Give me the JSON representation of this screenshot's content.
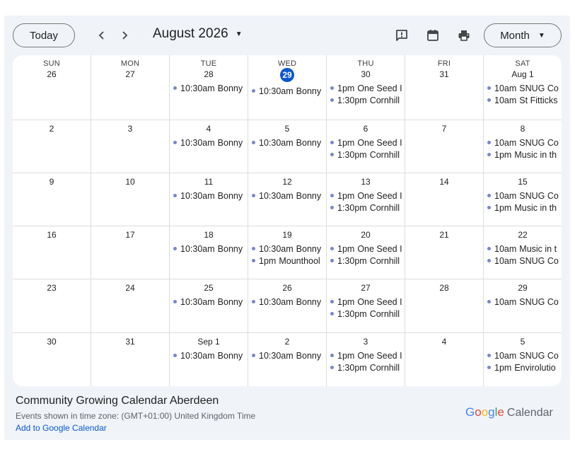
{
  "toolbar": {
    "today_label": "Today",
    "month_title": "August 2026",
    "view_label": "Month",
    "icons": [
      "chevron-left-icon",
      "chevron-right-icon",
      "feedback-icon",
      "calendar-icon",
      "print-icon",
      "caret-down-icon"
    ]
  },
  "weekdays": [
    "SUN",
    "MON",
    "TUE",
    "WED",
    "THU",
    "FRI",
    "SAT"
  ],
  "weeks": [
    [
      {
        "day": "26",
        "events": []
      },
      {
        "day": "27",
        "events": []
      },
      {
        "day": "28",
        "events": [
          {
            "time": "10:30am",
            "title": "Bonny"
          }
        ]
      },
      {
        "day": "29",
        "today": true,
        "events": [
          {
            "time": "10:30am",
            "title": "Bonny"
          }
        ]
      },
      {
        "day": "30",
        "events": [
          {
            "time": "1pm",
            "title": "One Seed I"
          },
          {
            "time": "1:30pm",
            "title": "Cornhill"
          }
        ]
      },
      {
        "day": "31",
        "events": []
      },
      {
        "day": "Aug 1",
        "events": [
          {
            "time": "10am",
            "title": "SNUG Co"
          },
          {
            "time": "10am",
            "title": "St Fitticks"
          }
        ]
      }
    ],
    [
      {
        "day": "2",
        "events": []
      },
      {
        "day": "3",
        "events": []
      },
      {
        "day": "4",
        "events": [
          {
            "time": "10:30am",
            "title": "Bonny"
          }
        ]
      },
      {
        "day": "5",
        "events": [
          {
            "time": "10:30am",
            "title": "Bonny"
          }
        ]
      },
      {
        "day": "6",
        "events": [
          {
            "time": "1pm",
            "title": "One Seed I"
          },
          {
            "time": "1:30pm",
            "title": "Cornhill"
          }
        ]
      },
      {
        "day": "7",
        "events": []
      },
      {
        "day": "8",
        "events": [
          {
            "time": "10am",
            "title": "SNUG Co"
          },
          {
            "time": "1pm",
            "title": "Music in th"
          }
        ]
      }
    ],
    [
      {
        "day": "9",
        "events": []
      },
      {
        "day": "10",
        "events": []
      },
      {
        "day": "11",
        "events": [
          {
            "time": "10:30am",
            "title": "Bonny"
          }
        ]
      },
      {
        "day": "12",
        "events": [
          {
            "time": "10:30am",
            "title": "Bonny"
          }
        ]
      },
      {
        "day": "13",
        "events": [
          {
            "time": "1pm",
            "title": "One Seed I"
          },
          {
            "time": "1:30pm",
            "title": "Cornhill"
          }
        ]
      },
      {
        "day": "14",
        "events": []
      },
      {
        "day": "15",
        "events": [
          {
            "time": "10am",
            "title": "SNUG Co"
          },
          {
            "time": "1pm",
            "title": "Music in th"
          }
        ]
      }
    ],
    [
      {
        "day": "16",
        "events": []
      },
      {
        "day": "17",
        "events": []
      },
      {
        "day": "18",
        "events": [
          {
            "time": "10:30am",
            "title": "Bonny"
          }
        ]
      },
      {
        "day": "19",
        "events": [
          {
            "time": "10:30am",
            "title": "Bonny"
          },
          {
            "time": "1pm",
            "title": "Mounthool"
          }
        ]
      },
      {
        "day": "20",
        "events": [
          {
            "time": "1pm",
            "title": "One Seed I"
          },
          {
            "time": "1:30pm",
            "title": "Cornhill"
          }
        ]
      },
      {
        "day": "21",
        "events": []
      },
      {
        "day": "22",
        "events": [
          {
            "time": "10am",
            "title": "Music in t"
          },
          {
            "time": "10am",
            "title": "SNUG Co"
          }
        ]
      }
    ],
    [
      {
        "day": "23",
        "events": []
      },
      {
        "day": "24",
        "events": []
      },
      {
        "day": "25",
        "events": [
          {
            "time": "10:30am",
            "title": "Bonny"
          }
        ]
      },
      {
        "day": "26",
        "events": [
          {
            "time": "10:30am",
            "title": "Bonny"
          }
        ]
      },
      {
        "day": "27",
        "events": [
          {
            "time": "1pm",
            "title": "One Seed I"
          },
          {
            "time": "1:30pm",
            "title": "Cornhill"
          }
        ]
      },
      {
        "day": "28",
        "events": []
      },
      {
        "day": "29",
        "events": [
          {
            "time": "10am",
            "title": "SNUG Co"
          }
        ]
      }
    ],
    [
      {
        "day": "30",
        "events": []
      },
      {
        "day": "31",
        "events": []
      },
      {
        "day": "Sep 1",
        "events": [
          {
            "time": "10:30am",
            "title": "Bonny"
          }
        ]
      },
      {
        "day": "2",
        "events": [
          {
            "time": "10:30am",
            "title": "Bonny"
          }
        ]
      },
      {
        "day": "3",
        "events": [
          {
            "time": "1pm",
            "title": "One Seed I"
          },
          {
            "time": "1:30pm",
            "title": "Cornhill"
          }
        ]
      },
      {
        "day": "4",
        "events": []
      },
      {
        "day": "5",
        "events": [
          {
            "time": "10am",
            "title": "SNUG Co"
          },
          {
            "time": "1pm",
            "title": "Envirolutio"
          }
        ]
      }
    ]
  ],
  "footer": {
    "calendar_name": "Community Growing Calendar Aberdeen",
    "timezone": "Events shown in time zone: (GMT+01:00) United Kingdom Time",
    "add_link": "Add to Google Calendar",
    "brand_google": "Google",
    "brand_calendar": "Calendar"
  },
  "colors": {
    "accent": "#0b57d0",
    "event_dot": "#7986cb",
    "background": "#f0f4f9"
  }
}
